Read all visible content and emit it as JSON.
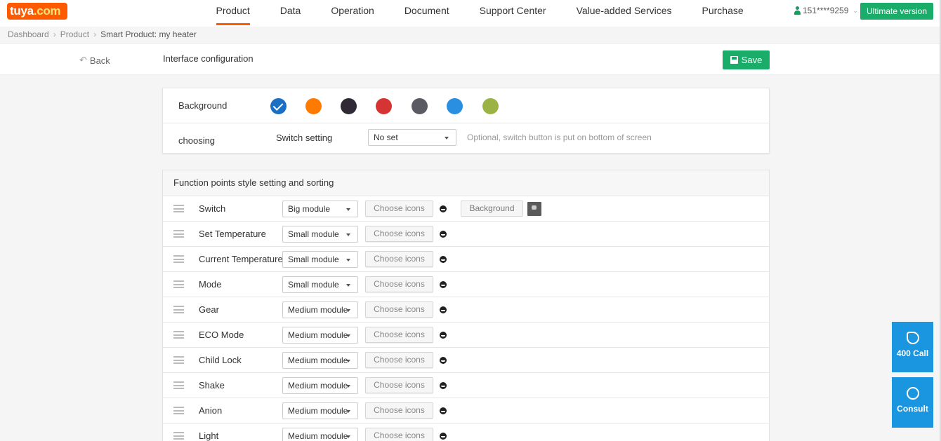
{
  "app": {
    "logo_text": "tuya",
    "logo_suffix": ".com"
  },
  "nav": {
    "items": [
      "Product",
      "Data",
      "Operation",
      "Document",
      "Support Center",
      "Value-added Services",
      "Purchase"
    ],
    "active": "Product"
  },
  "user": {
    "phone": "151****9259",
    "edition_button": "Ultimate version"
  },
  "breadcrumb": {
    "items": [
      "Dashboard",
      "Product",
      "Smart Product: my heater"
    ]
  },
  "header": {
    "back_label": "Back",
    "title": "Interface configuration",
    "save_label": "Save"
  },
  "background_section": {
    "label": "Background",
    "swatches": [
      {
        "color": "#1a6fc4",
        "selected": true
      },
      {
        "color": "#ff7a00",
        "selected": false
      },
      {
        "color": "#2f2a35",
        "selected": false
      },
      {
        "color": "#d63333",
        "selected": false
      },
      {
        "color": "#5b5c63",
        "selected": false
      },
      {
        "color": "#2a8fe0",
        "selected": false
      },
      {
        "color": "#9bb245",
        "selected": false
      }
    ],
    "choosing_label": "choosing",
    "switch_setting_label": "Switch setting",
    "switch_setting_value": "No set",
    "hint": "Optional, switch button is put on bottom of screen"
  },
  "function_section": {
    "title": "Function points style setting and sorting",
    "choose_icons_label": "Choose icons",
    "background_button": "Background",
    "rows": [
      {
        "name": "Switch",
        "style": "Big module",
        "has_background": true
      },
      {
        "name": "Set Temperature",
        "style": "Small module",
        "has_background": false
      },
      {
        "name": "Current Temperature",
        "style": "Small module",
        "has_background": false
      },
      {
        "name": "Mode",
        "style": "Small module",
        "has_background": false
      },
      {
        "name": "Gear",
        "style": "Medium module",
        "has_background": false
      },
      {
        "name": "ECO Mode",
        "style": "Medium module",
        "has_background": false
      },
      {
        "name": "Child Lock",
        "style": "Medium module",
        "has_background": false
      },
      {
        "name": "Shake",
        "style": "Medium module",
        "has_background": false
      },
      {
        "name": "Anion",
        "style": "Medium module",
        "has_background": false
      },
      {
        "name": "Light",
        "style": "Medium module",
        "has_background": false
      }
    ]
  },
  "floating": {
    "call_label": "400 Call",
    "consult_label": "Consult"
  },
  "colors": {
    "brand_orange": "#ff5a00",
    "primary_green": "#1aad6a",
    "float_blue": "#1a96e0"
  }
}
